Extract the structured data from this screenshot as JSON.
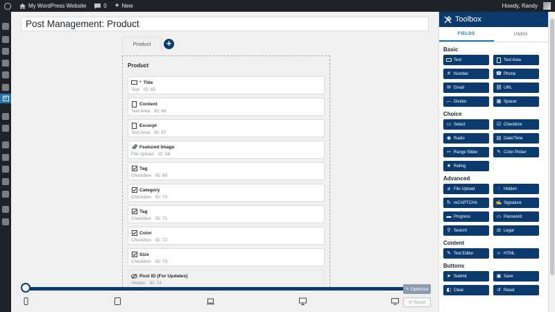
{
  "adminbar": {
    "site_name": "My WordPress Website",
    "comments_count": "0",
    "new_label": "New",
    "howdy": "Howdy, Randy"
  },
  "page": {
    "title_value": "Post Management: Product"
  },
  "tabs": [
    {
      "label": "Product"
    }
  ],
  "form": {
    "heading": "Product",
    "fields": [
      {
        "name": "Title",
        "required": "*",
        "type": "Text",
        "id": "ID: 65",
        "icon": "text-field-icon"
      },
      {
        "name": "Content",
        "type": "Text Area",
        "id": "ID: 66",
        "icon": "textarea-icon"
      },
      {
        "name": "Excerpt",
        "type": "Text Area",
        "id": "ID: 67",
        "icon": "textarea-icon"
      },
      {
        "name": "Featured Image",
        "type": "File Upload",
        "id": "ID: 68",
        "icon": "paperclip-icon"
      },
      {
        "name": "Tag",
        "type": "Checkbox",
        "id": "ID: 69",
        "icon": "checkbox-icon"
      },
      {
        "name": "Category",
        "type": "Checkbox",
        "id": "ID: 70",
        "icon": "checkbox-icon"
      },
      {
        "name": "Tag",
        "type": "Checkbox",
        "id": "ID: 71",
        "icon": "checkbox-icon"
      },
      {
        "name": "Color",
        "type": "Checkbox",
        "id": "ID: 72",
        "icon": "checkbox-icon"
      },
      {
        "name": "Size",
        "type": "Checkbox",
        "id": "ID: 73",
        "icon": "checkbox-icon"
      },
      {
        "name": "Post ID (For Updates)",
        "type": "Hidden",
        "id": "ID: 74",
        "icon": "eye-slash-icon"
      }
    ]
  },
  "preview": {
    "optimize_label": "Optimize",
    "reset_label": "Reset"
  },
  "toolbox": {
    "title": "Toolbox",
    "tabs": {
      "fields": "FIELDS",
      "undo": "UNDO"
    },
    "sections": [
      {
        "title": "Basic",
        "items": [
          "Text",
          "Text Area",
          "Number",
          "Phone",
          "Email",
          "URL",
          "Divider",
          "Spacer"
        ]
      },
      {
        "title": "Choice",
        "items": [
          "Select",
          "Checkbox",
          "Radio",
          "Date/Time",
          "Range Slider",
          "Color Picker",
          "Rating"
        ]
      },
      {
        "title": "Advanced",
        "items": [
          "File Upload",
          "Hidden",
          "reCAPTCHA",
          "Signature",
          "Progress",
          "Password",
          "Search",
          "Legal"
        ]
      },
      {
        "title": "Content",
        "items": [
          "Text Editor",
          "HTML"
        ]
      },
      {
        "title": "Buttons",
        "items": [
          "Submit",
          "Save",
          "Clear",
          "Reset"
        ]
      }
    ]
  },
  "colors": {
    "brand_navy": "#0b3b6e",
    "admin_dark": "#1d2327",
    "accent_blue": "#2271b1"
  }
}
